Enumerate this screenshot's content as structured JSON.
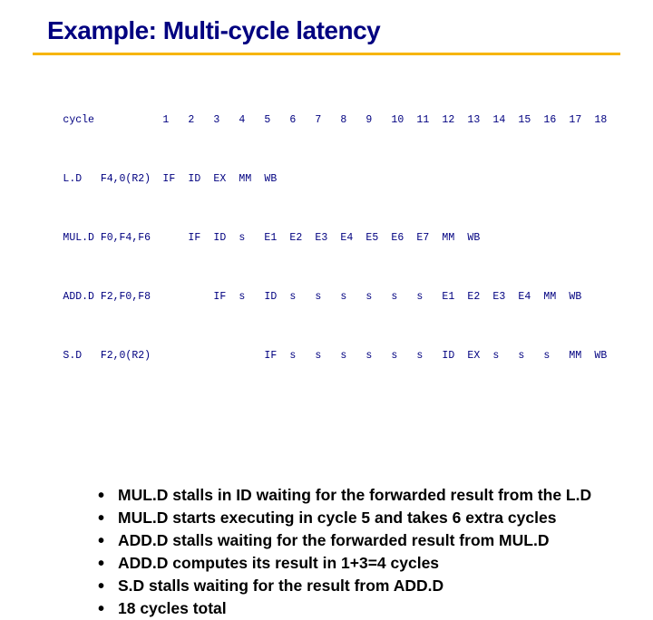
{
  "title": "Example: Multi-cycle latency",
  "pipe": {
    "header": {
      "label": "cycle",
      "cells": [
        "1",
        "2",
        "3",
        "4",
        "5",
        "6",
        "7",
        "8",
        "9",
        "10",
        "11",
        "12",
        "13",
        "14",
        "15",
        "16",
        "17",
        "18"
      ]
    },
    "rows": [
      {
        "label": "L.D   F4,0(R2)",
        "cells": [
          "IF",
          "ID",
          "EX",
          "MM",
          "WB",
          "",
          "",
          "",
          "",
          "",
          "",
          "",
          "",
          "",
          "",
          "",
          "",
          ""
        ]
      },
      {
        "label": "MUL.D F0,F4,F6",
        "cells": [
          "",
          "IF",
          "ID",
          "s",
          "E1",
          "E2",
          "E3",
          "E4",
          "E5",
          "E6",
          "E7",
          "MM",
          "WB",
          "",
          "",
          "",
          "",
          ""
        ]
      },
      {
        "label": "ADD.D F2,F0,F8",
        "cells": [
          "",
          "",
          "IF",
          "s",
          "ID",
          "s",
          "s",
          "s",
          "s",
          "s",
          "s",
          "E1",
          "E2",
          "E3",
          "E4",
          "MM",
          "WB",
          ""
        ]
      },
      {
        "label": "S.D   F2,0(R2)",
        "cells": [
          "",
          "",
          "",
          "",
          "IF",
          "s",
          "s",
          "s",
          "s",
          "s",
          "s",
          "ID",
          "EX",
          "s",
          "s",
          "s",
          "MM",
          "WB"
        ]
      }
    ]
  },
  "bullets": [
    "MUL.D stalls in ID waiting for the forwarded result from the L.D",
    "MUL.D starts executing in cycle 5 and takes 6 extra cycles",
    "ADD.D stalls waiting for the forwarded result from MUL.D",
    "ADD.D computes its result in 1+3=4 cycles",
    "S.D stalls waiting for the result from ADD.D",
    "18 cycles total"
  ]
}
